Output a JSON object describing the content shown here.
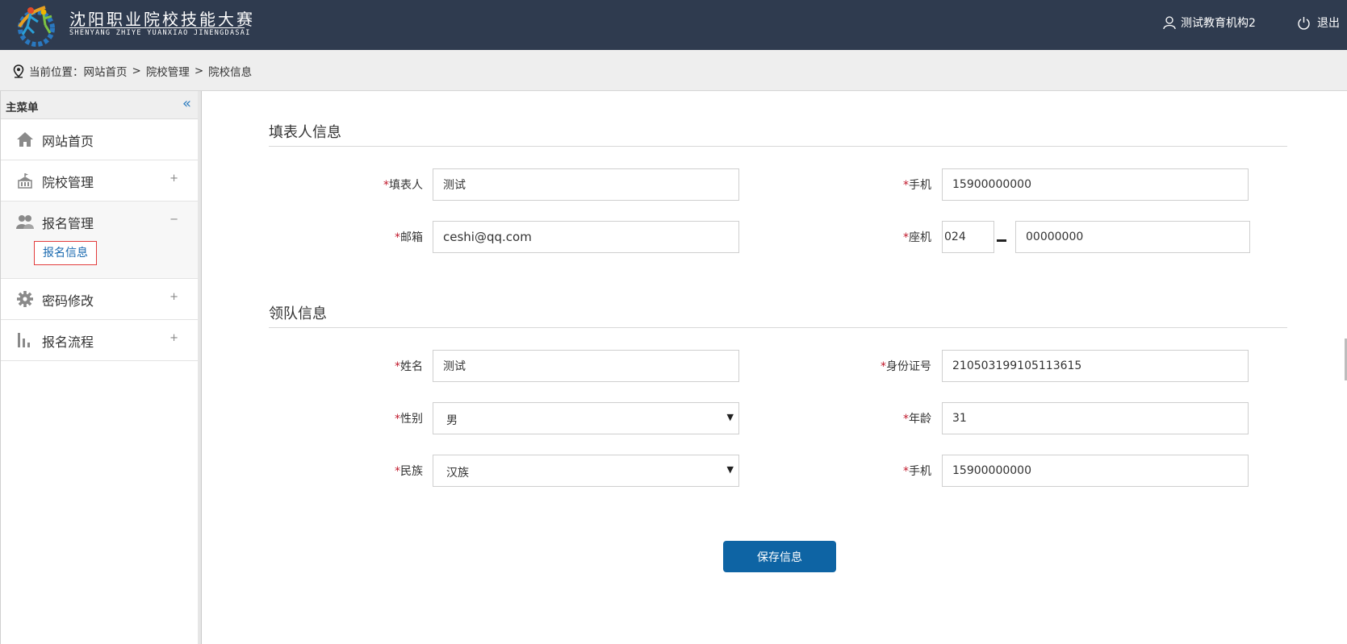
{
  "header": {
    "brand_cn": "沈阳职业院校技能大赛",
    "brand_en": "SHENYANG ZHIYE YUANXIAO JINENGDASAI",
    "user_name": "测试教育机构2",
    "logout_label": "退出",
    "bg_color": "#2f3b4f"
  },
  "breadcrumb": {
    "prefix": "当前位置：",
    "items": [
      "网站首页",
      "院校管理",
      "院校信息"
    ],
    "separator": ">"
  },
  "sidebar": {
    "title": "主菜单",
    "collapse_icon": "double-chevron-left-icon",
    "items": [
      {
        "label": "网站首页",
        "icon": "home-icon",
        "toggle": ""
      },
      {
        "label": "院校管理",
        "icon": "school-icon",
        "toggle": "+"
      },
      {
        "label": "报名管理",
        "icon": "users-icon",
        "toggle": "−",
        "sub_items": [
          {
            "label": "报名信息"
          }
        ]
      },
      {
        "label": "密码修改",
        "icon": "gear-icon",
        "toggle": "+"
      },
      {
        "label": "报名流程",
        "icon": "bar-chart-icon",
        "toggle": "+"
      }
    ]
  },
  "form": {
    "filler_section": {
      "title": "填表人信息",
      "filler": {
        "label": "填表人",
        "value": "测试"
      },
      "phone": {
        "label": "手机",
        "value": "15900000000"
      },
      "email": {
        "label": "邮箱",
        "value": "ceshi@qq.com"
      },
      "landline": {
        "label": "座机",
        "area_code": "024",
        "number": "00000000"
      }
    },
    "leader_section": {
      "title": "领队信息",
      "name": {
        "label": "姓名",
        "value": "测试"
      },
      "id_number": {
        "label": "身份证号",
        "value": "210503199105113615"
      },
      "gender": {
        "label": "性别",
        "value": "男"
      },
      "age": {
        "label": "年龄",
        "value": "31"
      },
      "ethnicity": {
        "label": "民族",
        "value": "汉族"
      },
      "phone": {
        "label": "手机",
        "value": "15900000000"
      }
    },
    "required_mark": "*",
    "save_label": "保存信息",
    "accent_color": "#0e64a4"
  }
}
